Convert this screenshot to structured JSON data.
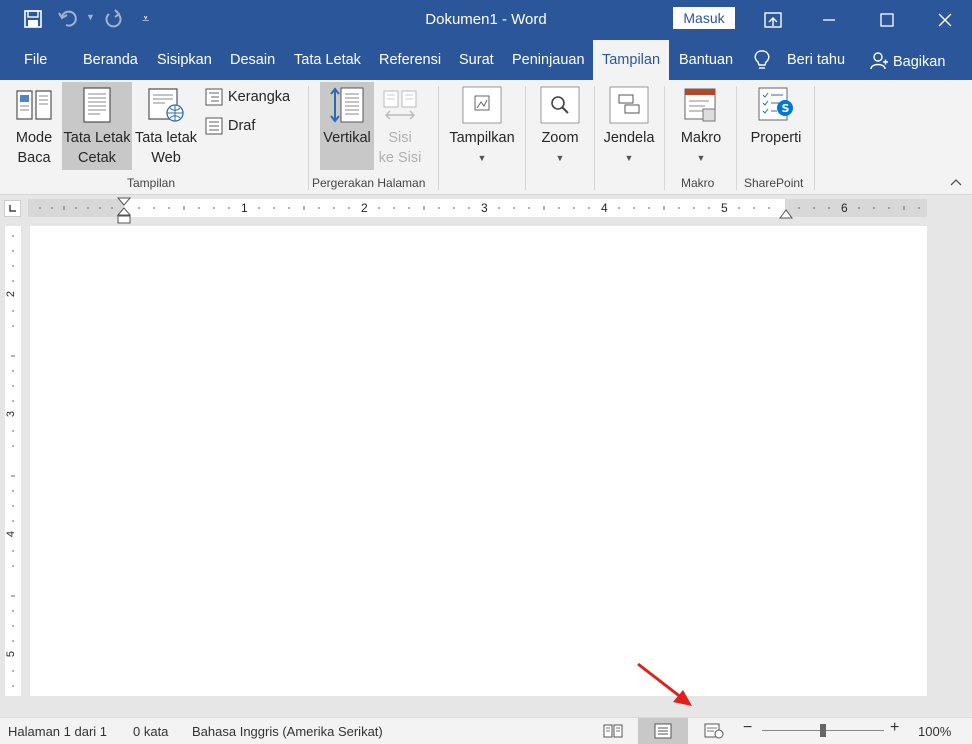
{
  "title": "Dokumen1  -  Word",
  "signin_label": "Masuk",
  "quick_access": {
    "save": "save-icon",
    "undo": "undo-icon",
    "redo": "redo-icon",
    "customize": "customize-icon"
  },
  "tabs": [
    "File",
    "Beranda",
    "Sisipkan",
    "Desain",
    "Tata Letak",
    "Referensi",
    "Surat",
    "Peninjauan",
    "Tampilan",
    "Bantuan"
  ],
  "tell_me": "Beri tahu",
  "share": "Bagikan",
  "ribbon": {
    "mode_baca": [
      "Mode",
      "Baca"
    ],
    "tata_letak_cetak": [
      "Tata Letak",
      "Cetak"
    ],
    "tata_letak_web": [
      "Tata letak",
      "Web"
    ],
    "kerangka": "Kerangka",
    "draf": "Draf",
    "group_tampilan": "Tampilan",
    "vertikal": "Vertikal",
    "sisi_ke_sisi": [
      "Sisi",
      "ke Sisi"
    ],
    "group_pergerakan": "Pergerakan Halaman",
    "tampilkan": "Tampilkan",
    "zoom": "Zoom",
    "jendela": "Jendela",
    "makro": "Makro",
    "group_makro": "Makro",
    "properti": "Properti",
    "group_sharepoint": "SharePoint"
  },
  "ruler_numbers": [
    "1",
    "2",
    "3",
    "4",
    "5",
    "6"
  ],
  "vruler_numbers": [
    "2",
    "3",
    "4",
    "5"
  ],
  "status": {
    "page": "Halaman 1 dari 1",
    "words": "0 kata",
    "language": "Bahasa Inggris (Amerika Serikat)",
    "zoom": "100%"
  },
  "colors": {
    "accent": "#2b579a",
    "annotation_arrow": "#e0201b"
  }
}
